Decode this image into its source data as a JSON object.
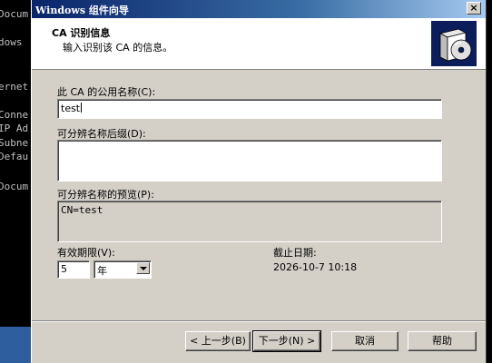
{
  "console": {
    "lines": [
      "Docum",
      "dows",
      "ernet",
      "Conne",
      "IP Ad",
      "Subne",
      "Defau",
      "Docum"
    ]
  },
  "dialog": {
    "title": "Windows 组件向导",
    "close_glyph": "×",
    "header": {
      "title": "CA 识别信息",
      "subtitle": "输入识别该 CA 的信息。"
    },
    "common_name": {
      "label": "此 CA 的公用名称(C):",
      "value": "test"
    },
    "dn_suffix": {
      "label": "可分辨名称后缀(D):",
      "value": ""
    },
    "dn_preview": {
      "label": "可分辨名称的预览(P):",
      "value": "CN=test"
    },
    "validity": {
      "label": "有效期限(V):",
      "value": "5",
      "unit": "年"
    },
    "expiration": {
      "label": "截止日期:",
      "value": "2026-10-7 10:18"
    },
    "buttons": {
      "back": "< 上一步(B)",
      "next": "下一步(N) >",
      "cancel": "取消",
      "help": "帮助"
    }
  }
}
